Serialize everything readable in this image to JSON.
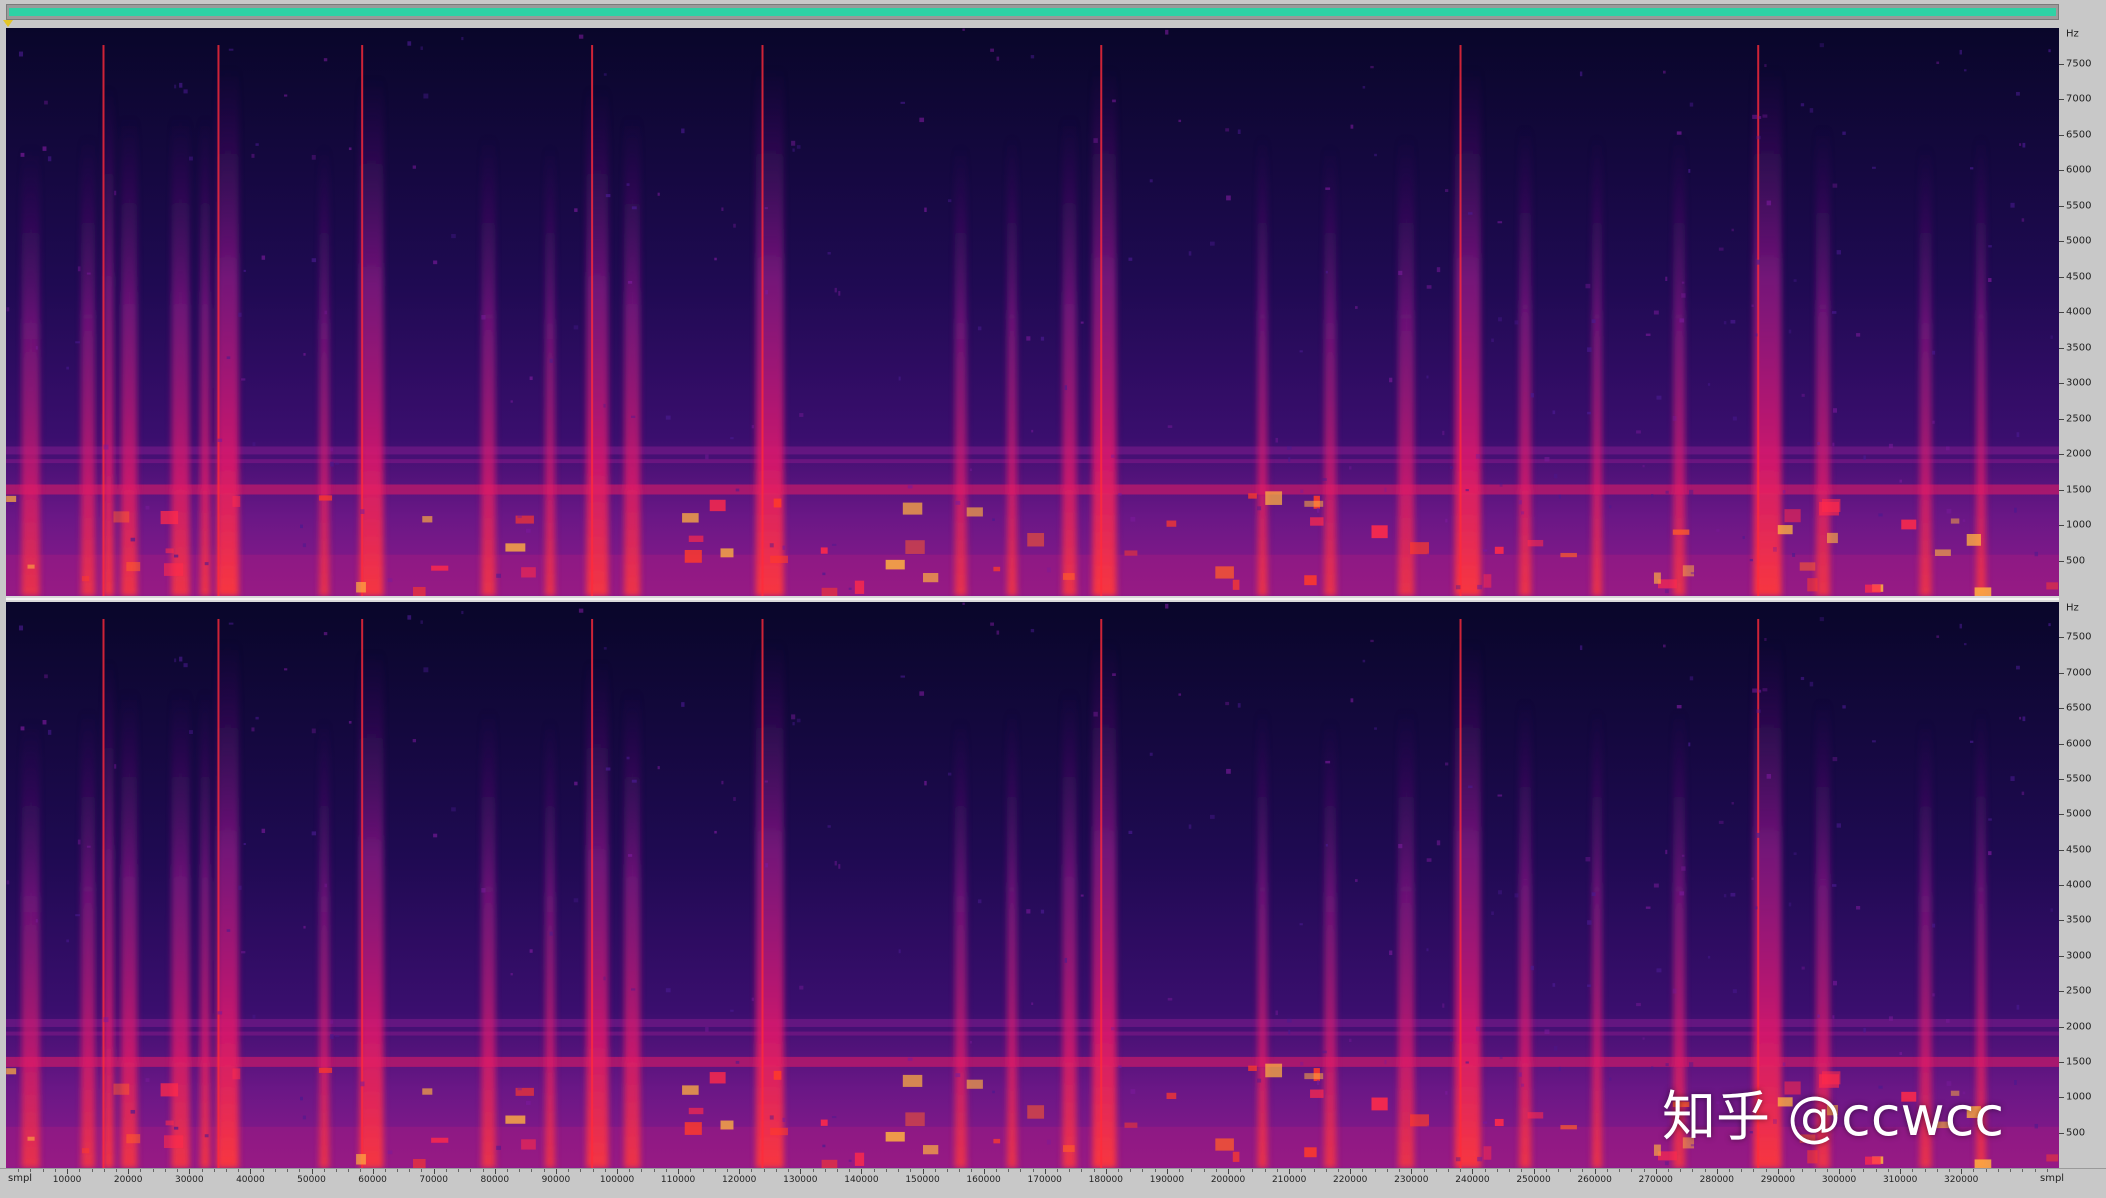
{
  "app": {
    "view": "spectral frequency display",
    "channels": 2
  },
  "colors": {
    "background": "#09062a",
    "low_energy": "#2a0b5e",
    "mid_energy": "#9a1a8a",
    "high_energy": "#e8183f",
    "peak_energy": "#ffcc55",
    "overview_bar": "#2fd2a5",
    "ui_chrome": "#c8c8c8"
  },
  "frequency_axis": {
    "unit": "Hz",
    "labels": [
      "500",
      "1000",
      "1500",
      "2000",
      "2500",
      "3000",
      "3500",
      "4000",
      "4500",
      "5000",
      "5500",
      "6000",
      "6500",
      "7000",
      "7500"
    ],
    "range": [
      0,
      8000
    ]
  },
  "time_axis": {
    "unit": "smpl",
    "labels": [
      "10000",
      "20000",
      "30000",
      "40000",
      "50000",
      "60000",
      "70000",
      "80000",
      "90000",
      "100000",
      "110000",
      "120000",
      "130000",
      "140000",
      "150000",
      "160000",
      "170000",
      "180000",
      "190000",
      "200000",
      "210000",
      "220000",
      "230000",
      "240000",
      "250000",
      "260000",
      "270000",
      "280000",
      "290000",
      "300000",
      "310000",
      "320000"
    ],
    "range": [
      0,
      336000
    ]
  },
  "watermark": "知乎 @ccwcc"
}
